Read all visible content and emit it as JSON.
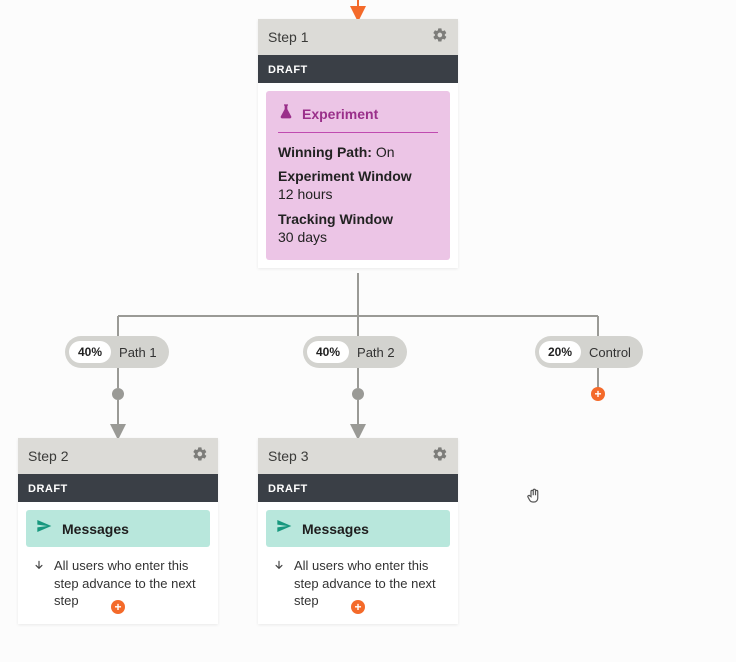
{
  "step1": {
    "title": "Step 1",
    "status": "DRAFT",
    "experiment": {
      "label": "Experiment",
      "winning_path_label": "Winning Path:",
      "winning_path_value": "On",
      "exp_window_label": "Experiment Window",
      "exp_window_value": "12 hours",
      "track_window_label": "Tracking Window",
      "track_window_value": "30 days"
    }
  },
  "branches": {
    "path1": {
      "pct": "40%",
      "label": "Path 1"
    },
    "path2": {
      "pct": "40%",
      "label": "Path 2"
    },
    "control": {
      "pct": "20%",
      "label": "Control"
    }
  },
  "step2": {
    "title": "Step 2",
    "status": "DRAFT",
    "messages_label": "Messages",
    "advance_text": "All users who enter this step advance to the next step"
  },
  "step3": {
    "title": "Step 3",
    "status": "DRAFT",
    "messages_label": "Messages",
    "advance_text": "All users who enter this step advance to the next step"
  }
}
